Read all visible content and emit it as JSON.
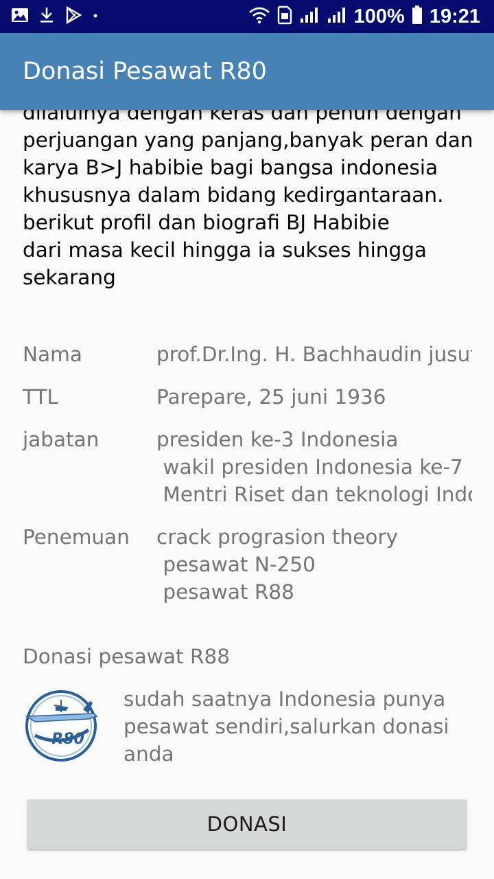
{
  "status_bar": {
    "battery": "100%",
    "time": "19:21",
    "left_icons": [
      "image-icon",
      "download-icon",
      "play-store-icon",
      "dot-icon"
    ],
    "right_icons": [
      "wifi-icon",
      "sim-icon",
      "signal-icon",
      "signal-icon-2",
      "battery-icon"
    ]
  },
  "app_bar": {
    "title": "Donasi Pesawat R80"
  },
  "intro": {
    "text": "dilaluinya dengan keras dan penuh dengan\nperjuangan yang panjang,banyak peran dan\nkarya B>J habibie bagi bangsa indonesia\nkhususnya dalam bidang kedirgantaraan.\nberikut profil dan biografi BJ Habibie\ndari masa kecil hingga ia sukses hingga\nsekarang"
  },
  "profile": {
    "nama_label": "Nama",
    "nama_value": "prof.Dr.Ing. H. Bachhaudin jusuf habibie",
    "ttl_label": "TTL",
    "ttl_value": "Parepare, 25 juni 1936",
    "jabatan_label": "jabatan",
    "jabatan_value": "presiden ke-3 Indonesia\n wakil presiden Indonesia ke-7\n Mentri Riset dan teknologi Indonesia",
    "penemuan_label": "Penemuan",
    "penemuan_value": "crack prograsion theory\n pesawat N-250\n pesawat R88"
  },
  "donation": {
    "title": "Donasi pesawat R88",
    "logo_text": "R80",
    "description": "sudah saatnya Indonesia punya pesawat sendiri,salurkan donasi anda",
    "button_label": "DONASI"
  },
  "colors": {
    "status_bar": "#050a6e",
    "app_bar": "#4682b4",
    "background": "#fafafa",
    "secondary_text": "#757575",
    "button": "#d6d7d7"
  }
}
